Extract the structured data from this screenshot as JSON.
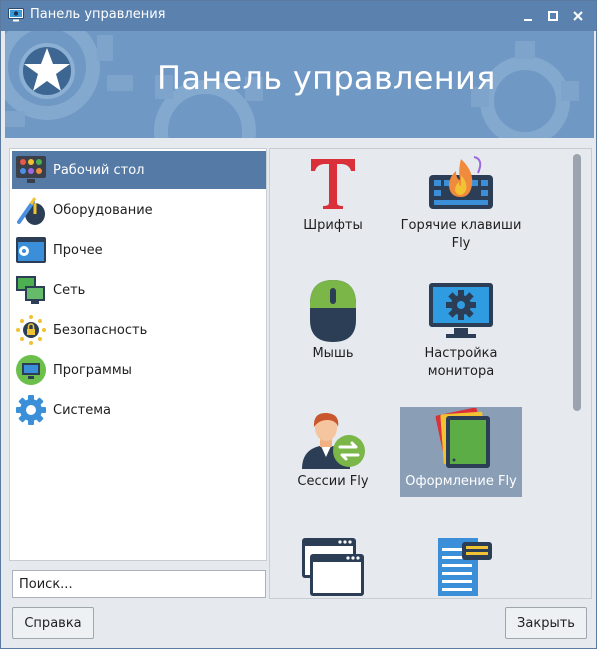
{
  "window": {
    "title": "Панель управления",
    "controls": [
      "minimize-icon",
      "maximize-icon",
      "close-icon"
    ]
  },
  "banner": {
    "title": "Панель управления"
  },
  "categories": [
    {
      "label": "Рабочий стол",
      "icon": "desktop-icon",
      "selected": true
    },
    {
      "label": "Оборудование",
      "icon": "hardware-icon",
      "selected": false
    },
    {
      "label": "Прочее",
      "icon": "other-settings-icon",
      "selected": false
    },
    {
      "label": "Сеть",
      "icon": "network-icon",
      "selected": false
    },
    {
      "label": "Безопасность",
      "icon": "security-lock-icon",
      "selected": false
    },
    {
      "label": "Программы",
      "icon": "programs-icon",
      "selected": false
    },
    {
      "label": "Система",
      "icon": "system-gear-icon",
      "selected": false
    }
  ],
  "search": {
    "value": "Поиск..."
  },
  "items": [
    {
      "label": "Шрифты",
      "icon": "fonts-icon",
      "selected": false
    },
    {
      "label": "Горячие клавиши Fly",
      "icon": "hotkeys-keyboard-icon",
      "selected": false
    },
    {
      "label": "Мышь",
      "icon": "mouse-icon",
      "selected": false
    },
    {
      "label": "Настройка монитора",
      "icon": "monitor-settings-icon",
      "selected": false
    },
    {
      "label": "Сессии Fly",
      "icon": "sessions-user-icon",
      "selected": false
    },
    {
      "label": "Оформление Fly",
      "icon": "theme-cards-icon",
      "selected": true
    },
    {
      "label": "",
      "icon": "windows-icon",
      "selected": false
    },
    {
      "label": "",
      "icon": "document-list-icon",
      "selected": false
    }
  ],
  "buttons": {
    "help": "Справка",
    "close": "Закрыть"
  },
  "colors": {
    "titlebar": "#5b82ae",
    "banner": "#6f98c4",
    "selection": "#557aa5",
    "tile_selection": "#8a9fb6"
  }
}
